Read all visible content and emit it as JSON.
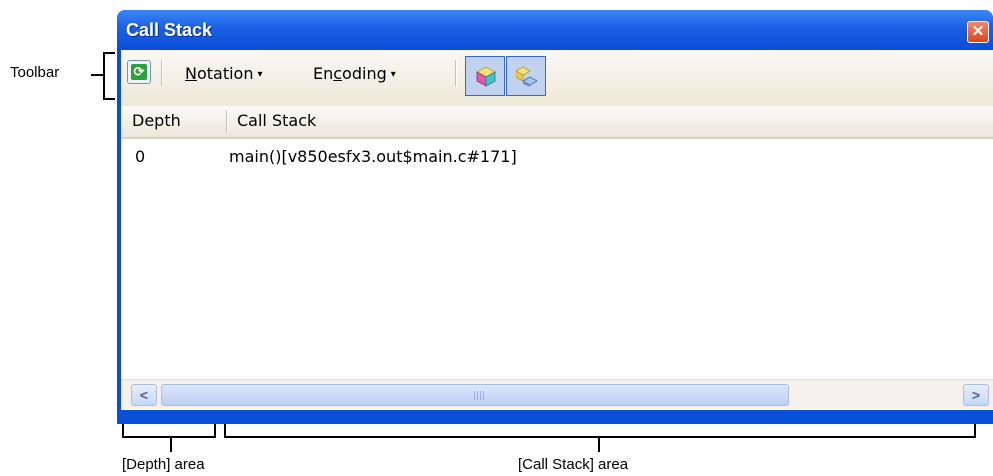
{
  "window": {
    "title": "Call Stack",
    "close_glyph": "✕"
  },
  "toolbar": {
    "refresh_icon": "refresh-icon",
    "notation_label": "Notation",
    "notation_accel": "N",
    "notation_rest": "otation",
    "encoding_pre": "En",
    "encoding_accel": "c",
    "encoding_rest": "oding",
    "dropdown_arrow": "▾"
  },
  "table": {
    "headers": [
      "Depth",
      "Call Stack"
    ],
    "rows": [
      {
        "depth": "0",
        "call_stack": "main()[v850esfx3.out$main.c#171]"
      }
    ]
  },
  "annotations": {
    "toolbar": "Toolbar",
    "depth_area": "[Depth] area",
    "callstack_area": "[Call Stack] area"
  },
  "colors": {
    "title_bar": "#1c5fe4",
    "frame": "#0a4fd8",
    "toolbar_bg": "#ece9d8"
  }
}
